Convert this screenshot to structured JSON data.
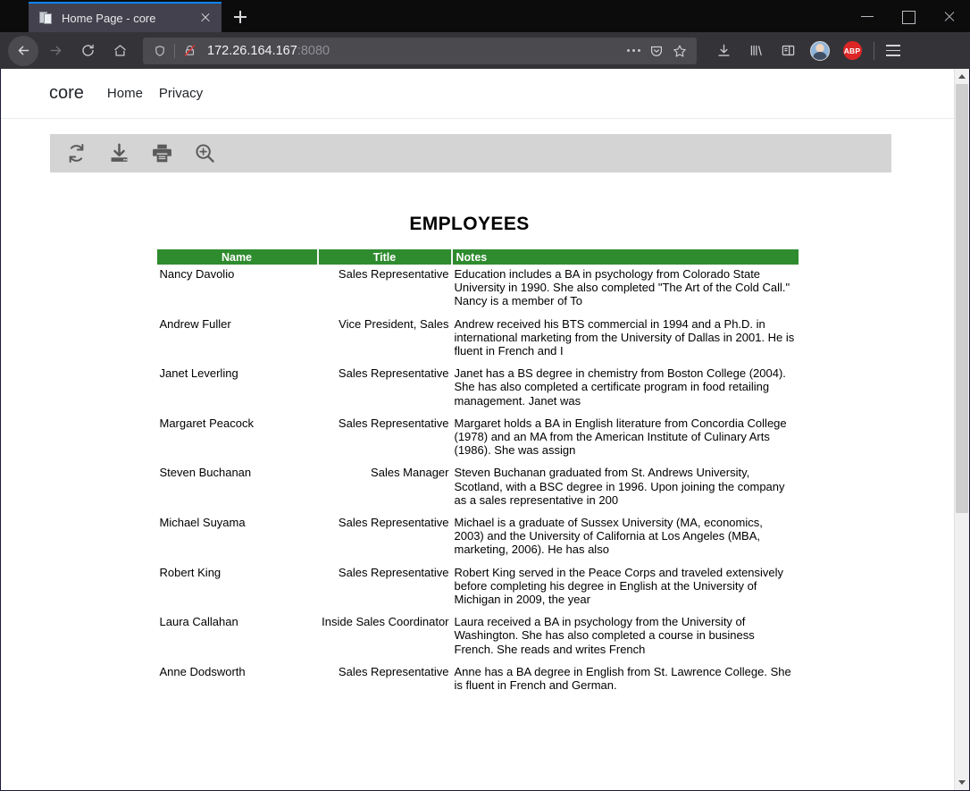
{
  "browser": {
    "tab": {
      "title": "Home Page - core",
      "favicon": "page-icon"
    },
    "new_tab_label": "+",
    "window_controls": {
      "minimize": "minimize",
      "maximize": "maximize",
      "close": "close"
    },
    "nav": {
      "back": "back-arrow",
      "forward": "forward-arrow",
      "reload": "reload",
      "home": "home"
    },
    "url": {
      "host": "172.26.164.167",
      "port": ":8080",
      "full": "172.26.164.167:8080"
    },
    "url_icons": {
      "shield": "shield-icon",
      "insecure_lock": "lock-crossed-icon"
    },
    "url_actions": {
      "more": "page-actions-more",
      "pocket": "save-to-pocket",
      "bookmark": "bookmark-star"
    },
    "toolbar_right": {
      "downloads": "downloads-icon",
      "library": "library-icon",
      "sidebar": "sidebar-icon",
      "account": "account-avatar",
      "adblock_label": "ABP",
      "menu": "hamburger-menu"
    }
  },
  "site": {
    "brand": "core",
    "nav_links": [
      {
        "label": "Home"
      },
      {
        "label": "Privacy"
      }
    ]
  },
  "report_toolbar": {
    "buttons": [
      {
        "name": "refresh",
        "icon": "refresh-icon"
      },
      {
        "name": "export",
        "icon": "download-export-icon"
      },
      {
        "name": "print",
        "icon": "print-icon"
      },
      {
        "name": "zoom",
        "icon": "magnifier-plus-icon"
      }
    ]
  },
  "report": {
    "title": "EMPLOYEES",
    "header_color": "#2e8b2e",
    "header_text_color": "#ffffff",
    "columns": [
      "Name",
      "Title",
      "Notes"
    ],
    "rows": [
      {
        "name": "Nancy  Davolio",
        "title": "Sales Representative",
        "notes": "Education includes a BA in psychology from Colorado State University in 1990.  She also completed \"The Art of the Cold Call.\"  Nancy is a member of To"
      },
      {
        "name": "Andrew  Fuller",
        "title": "Vice President, Sales",
        "notes": "Andrew received his BTS commercial in 1994 and a Ph.D. in international marketing from the University of Dallas in 2001.  He is fluent in French and I"
      },
      {
        "name": "Janet  Leverling",
        "title": "Sales Representative",
        "notes": "Janet has a BS degree in chemistry from Boston College (2004).  She has also completed a certificate program in food retailing management.  Janet was"
      },
      {
        "name": "Margaret  Peacock",
        "title": "Sales Representative",
        "notes": "Margaret holds a BA in English literature from Concordia College (1978) and an MA from the American Institute of Culinary Arts (1986).  She was assign"
      },
      {
        "name": "Steven  Buchanan",
        "title": "Sales Manager",
        "notes": "Steven Buchanan graduated from St. Andrews University, Scotland, with a BSC degree in 1996.  Upon joining the company as a sales representative in 200"
      },
      {
        "name": "Michael  Suyama",
        "title": "Sales Representative",
        "notes": "Michael is a graduate of Sussex University (MA, economics, 2003) and the University of California at Los Angeles (MBA, marketing, 2006).  He has also"
      },
      {
        "name": "Robert  King",
        "title": "Sales Representative",
        "notes": "Robert King served in the Peace Corps and traveled extensively before completing his degree in English at the University of Michigan in 2009, the year"
      },
      {
        "name": "Laura  Callahan",
        "title": "Inside Sales Coordinator",
        "notes": "Laura received a BA in psychology from the University of Washington.  She has also completed a course in business French.  She reads and writes French"
      },
      {
        "name": "Anne  Dodsworth",
        "title": "Sales Representative",
        "notes": "Anne has a BA degree in English from St. Lawrence College.  She is fluent in French and German."
      }
    ]
  }
}
